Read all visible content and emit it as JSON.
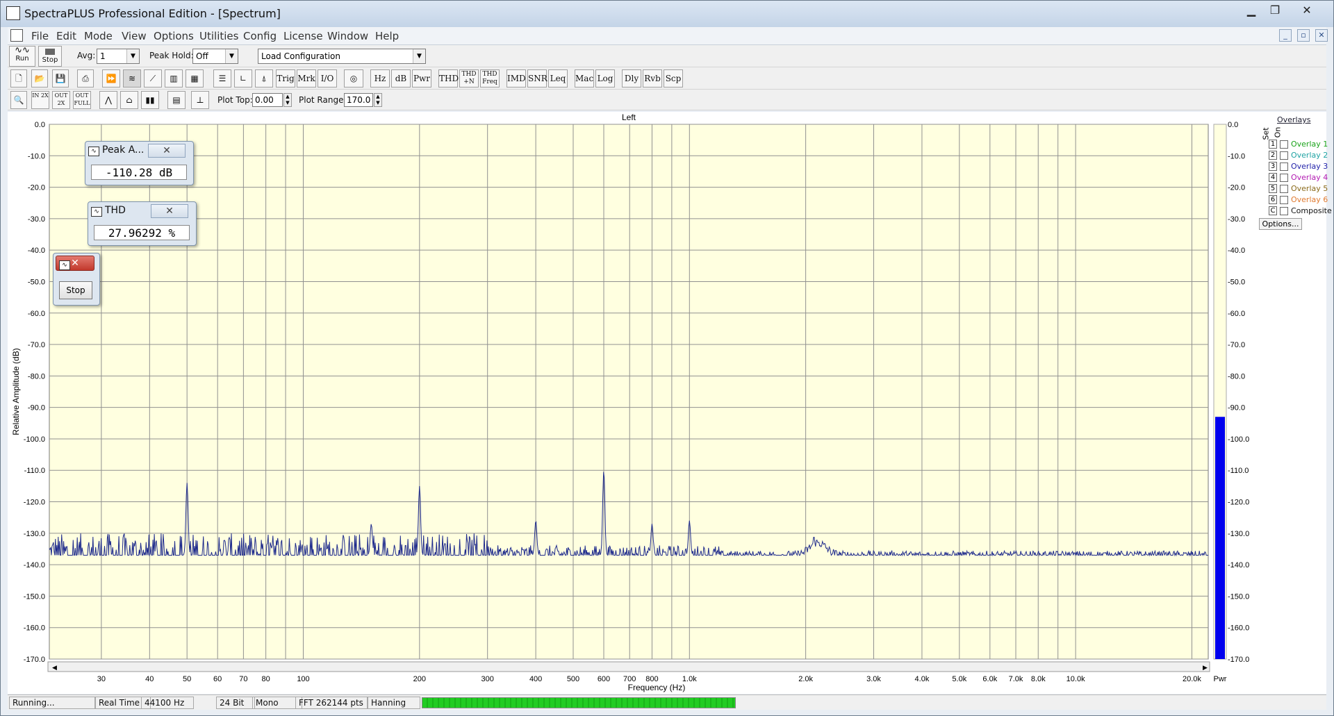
{
  "app": {
    "title": "SpectraPLUS Professional Edition - [Spectrum]"
  },
  "window_buttons": [
    "minimize",
    "restore",
    "close"
  ],
  "menu": [
    "File",
    "Edit",
    "Mode",
    "View",
    "Options",
    "Utilities",
    "Config",
    "License",
    "Window",
    "Help"
  ],
  "toolbar1": {
    "run_label": "Run",
    "stop_label": "Stop",
    "avg_label": "Avg:",
    "avg_value": "1",
    "peak_hold_label": "Peak Hold:",
    "peak_hold_value": "Off",
    "config_value": "Load Configuration"
  },
  "toolbar2": {
    "text_buttons": [
      "Trig",
      "Mrk",
      "I/O",
      "Hz",
      "dB",
      "Pwr",
      "THD",
      "THD +N",
      "THD Freq",
      "IMD",
      "SNR",
      "Leq",
      "Mac",
      "Log",
      "Dly",
      "Rvb",
      "Scp"
    ]
  },
  "toolbar3": {
    "zoom_buttons": [
      "IN 2X",
      "OUT 2X",
      "OUT FULL"
    ],
    "plot_top_label": "Plot Top:",
    "plot_top_value": "0.00",
    "plot_range_label": "Plot Range:",
    "plot_range_value": "170.0"
  },
  "plot": {
    "channel_label": "Left",
    "power_label": "Pwr",
    "power_level_db": -93
  },
  "chart_data": {
    "type": "line",
    "xlabel": "Frequency (Hz)",
    "ylabel": "Relative Amplitude (dB)",
    "x_scale": "log",
    "xlim": [
      22,
      22050
    ],
    "ylim": [
      -170,
      0
    ],
    "xtick_labels": [
      "30",
      "40",
      "50",
      "60",
      "70",
      "80",
      "100",
      "200",
      "300",
      "400",
      "500",
      "600",
      "700",
      "800",
      "1.0k",
      "2.0k",
      "3.0k",
      "4.0k",
      "5.0k",
      "6.0k",
      "7.0k",
      "8.0k",
      "10.0k",
      "20.0k"
    ],
    "xtick_values": [
      30,
      40,
      50,
      60,
      70,
      80,
      100,
      200,
      300,
      400,
      500,
      600,
      700,
      800,
      1000,
      2000,
      3000,
      4000,
      5000,
      6000,
      7000,
      8000,
      10000,
      20000
    ],
    "ytick_labels": [
      "0.0",
      "-10.0",
      "-20.0",
      "-30.0",
      "-40.0",
      "-50.0",
      "-60.0",
      "-70.0",
      "-80.0",
      "-90.0",
      "-100.0",
      "-110.0",
      "-120.0",
      "-130.0",
      "-140.0",
      "-150.0",
      "-160.0",
      "-170.0"
    ],
    "grid": true,
    "series": [
      {
        "name": "Left",
        "color": "#1e2a8c",
        "peaks": [
          {
            "x": 50,
            "y": -114
          },
          {
            "x": 150,
            "y": -127
          },
          {
            "x": 200,
            "y": -115
          },
          {
            "x": 400,
            "y": -126
          },
          {
            "x": 600,
            "y": -110
          },
          {
            "x": 800,
            "y": -127
          },
          {
            "x": 1000,
            "y": -126
          },
          {
            "x": 2100,
            "y": -131
          }
        ],
        "noise_floor_db": -137
      }
    ]
  },
  "popups": {
    "peak_title": "Peak A...",
    "peak_value": "-110.28 dB",
    "thd_title": "THD",
    "thd_value": "27.96292 %",
    "stop_label": "Stop"
  },
  "overlays": {
    "title": "Overlays",
    "set_header": "Set",
    "on_header": "On",
    "items": [
      {
        "num": "1",
        "label": "Overlay 1",
        "color": "#1aa31a"
      },
      {
        "num": "2",
        "label": "Overlay 2",
        "color": "#1fa3a3"
      },
      {
        "num": "3",
        "label": "Overlay 3",
        "color": "#2222aa"
      },
      {
        "num": "4",
        "label": "Overlay 4",
        "color": "#b21ab2"
      },
      {
        "num": "5",
        "label": "Overlay 5",
        "color": "#8a6a1a"
      },
      {
        "num": "6",
        "label": "Overlay 6",
        "color": "#e07a30"
      },
      {
        "num": "C",
        "label": "Composite",
        "color": "#111111"
      }
    ],
    "options_label": "Options..."
  },
  "status": {
    "state": "Running...",
    "mode": "Real Time",
    "rate": "44100 Hz",
    "bits": "24 Bit",
    "channels": "Mono",
    "fft": "FFT 262144 pts",
    "window": "Hanning",
    "progress": 1.0
  }
}
